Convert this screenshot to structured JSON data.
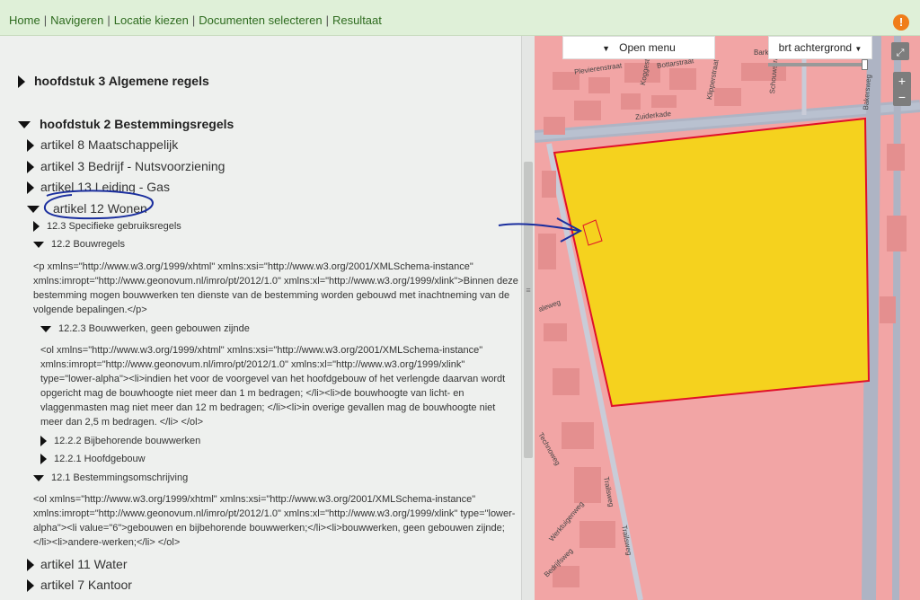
{
  "nav": {
    "items": [
      "Home",
      "Navigeren",
      "Locatie kiezen",
      "Documenten selecteren",
      "Resultaat"
    ],
    "separator": "|",
    "alert_icon": "exclamation-icon"
  },
  "tree": {
    "h3": "hoofdstuk 3 Algemene regels",
    "h2": "hoofdstuk 2 Bestemmingsregels",
    "art8": "artikel 8 Maatschappelijk",
    "art3": "artikel 3 Bedrijf - Nutsvoorziening",
    "art13": "artikel 13 Leiding - Gas",
    "art12": "artikel 12 Wonen",
    "s12_3": "12.3 Specifieke gebruiksregels",
    "s12_2": "12.2 Bouwregels",
    "p12_2": "<p xmlns=\"http://www.w3.org/1999/xhtml\" xmlns:xsi=\"http://www.w3.org/2001/XMLSchema-instance\" xmlns:imropt=\"http://www.geonovum.nl/imro/pt/2012/1.0\" xmlns:xl=\"http://www.w3.org/1999/xlink\">Binnen deze bestemming mogen bouwwerken ten dienste van de bestemming worden gebouwd met inachtneming van de volgende bepalingen.</p>",
    "s12_2_3": "12.2.3 Bouwwerken, geen gebouwen zijnde",
    "p12_2_3": "<ol xmlns=\"http://www.w3.org/1999/xhtml\" xmlns:xsi=\"http://www.w3.org/2001/XMLSchema-instance\" xmlns:imropt=\"http://www.geonovum.nl/imro/pt/2012/1.0\" xmlns:xl=\"http://www.w3.org/1999/xlink\" type=\"lower-alpha\"><li>indien het voor de voorgevel van het hoofdgebouw of het verlengde daarvan wordt opgericht mag de bouwhoogte niet meer dan 1 m bedragen; </li><li>de bouwhoogte van licht- en vlaggenmasten mag niet meer dan 12 m bedragen; </li><li>in overige gevallen mag de bouwhoogte niet meer dan 2,5 m bedragen. </li> </ol>",
    "s12_2_2": "12.2.2 Bijbehorende bouwwerken",
    "s12_2_1": "12.2.1 Hoofdgebouw",
    "s12_1": "12.1 Bestemmingsomschrijving",
    "p12_1": "<ol xmlns=\"http://www.w3.org/1999/xhtml\" xmlns:xsi=\"http://www.w3.org/2001/XMLSchema-instance\" xmlns:imropt=\"http://www.geonovum.nl/imro/pt/2012/1.0\" xmlns:xl=\"http://www.w3.org/1999/xlink\" type=\"lower-alpha\"><li value=\"6\">gebouwen en bijbehorende bouwwerken;</li><li>bouwwerken, geen gebouwen zijnde;</li><li>andere-werken;</li> </ol>",
    "art11": "artikel 11 Water",
    "art7": "artikel 7 Kantoor"
  },
  "map": {
    "open_menu": "Open menu",
    "background": "brt achtergrond",
    "zoom_in": "+",
    "zoom_out": "−",
    "colors": {
      "plan_area": "#f2a5a5",
      "selected_plan": "#f5d21e",
      "selected_border": "#e0102a",
      "roads": "#aeb4c4"
    },
    "streets": {
      "plevierenstraat": "Plevierenstraat",
      "bottarstraat": "Bottarstraat",
      "barkst": "Barkst",
      "koggestraat": "Koggestraat",
      "klipperstraat": "Klipperstraat",
      "schouwstraat": "Schouwstra",
      "zuiderkade": "Zuiderkade",
      "bakersweg": "Bakersweg",
      "alkweg": "aleweg",
      "trailsweg": "Trailsweg",
      "trailsweg2": "Trailsweg",
      "technoweg": "Technoweg",
      "werkstuigenweg": "Werktuigenweg",
      "bedrijfsweg": "Bedrijfsweg"
    }
  }
}
